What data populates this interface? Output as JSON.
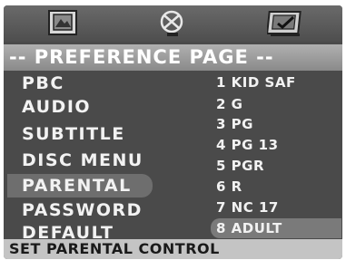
{
  "top_icons": [
    {
      "name": "general-setup-icon"
    },
    {
      "name": "speaker-setup-icon"
    },
    {
      "name": "preference-icon"
    }
  ],
  "page_title": "-- PREFERENCE PAGE --",
  "menu": {
    "items": [
      {
        "label": "PBC"
      },
      {
        "label": "AUDIO"
      },
      {
        "label": "SUBTITLE"
      },
      {
        "label": "DISC MENU"
      },
      {
        "label": "PARENTAL"
      },
      {
        "label": "PASSWORD"
      },
      {
        "label": "DEFAULT"
      }
    ],
    "selected": "PARENTAL"
  },
  "options": {
    "items": [
      {
        "label": "1 KID SAF"
      },
      {
        "label": "2 G"
      },
      {
        "label": "3 PG"
      },
      {
        "label": "4 PG 13"
      },
      {
        "label": "5 PGR"
      },
      {
        "label": "6 R"
      },
      {
        "label": "7 NC 17"
      },
      {
        "label": "8 ADULT"
      }
    ],
    "selected": "8 ADULT"
  },
  "status_text": "SET PARENTAL CONTROL",
  "colors": {
    "screen_bg": "#4a4a4a",
    "text": "#f2f2f2",
    "status_bg": "#c4c4c4"
  }
}
